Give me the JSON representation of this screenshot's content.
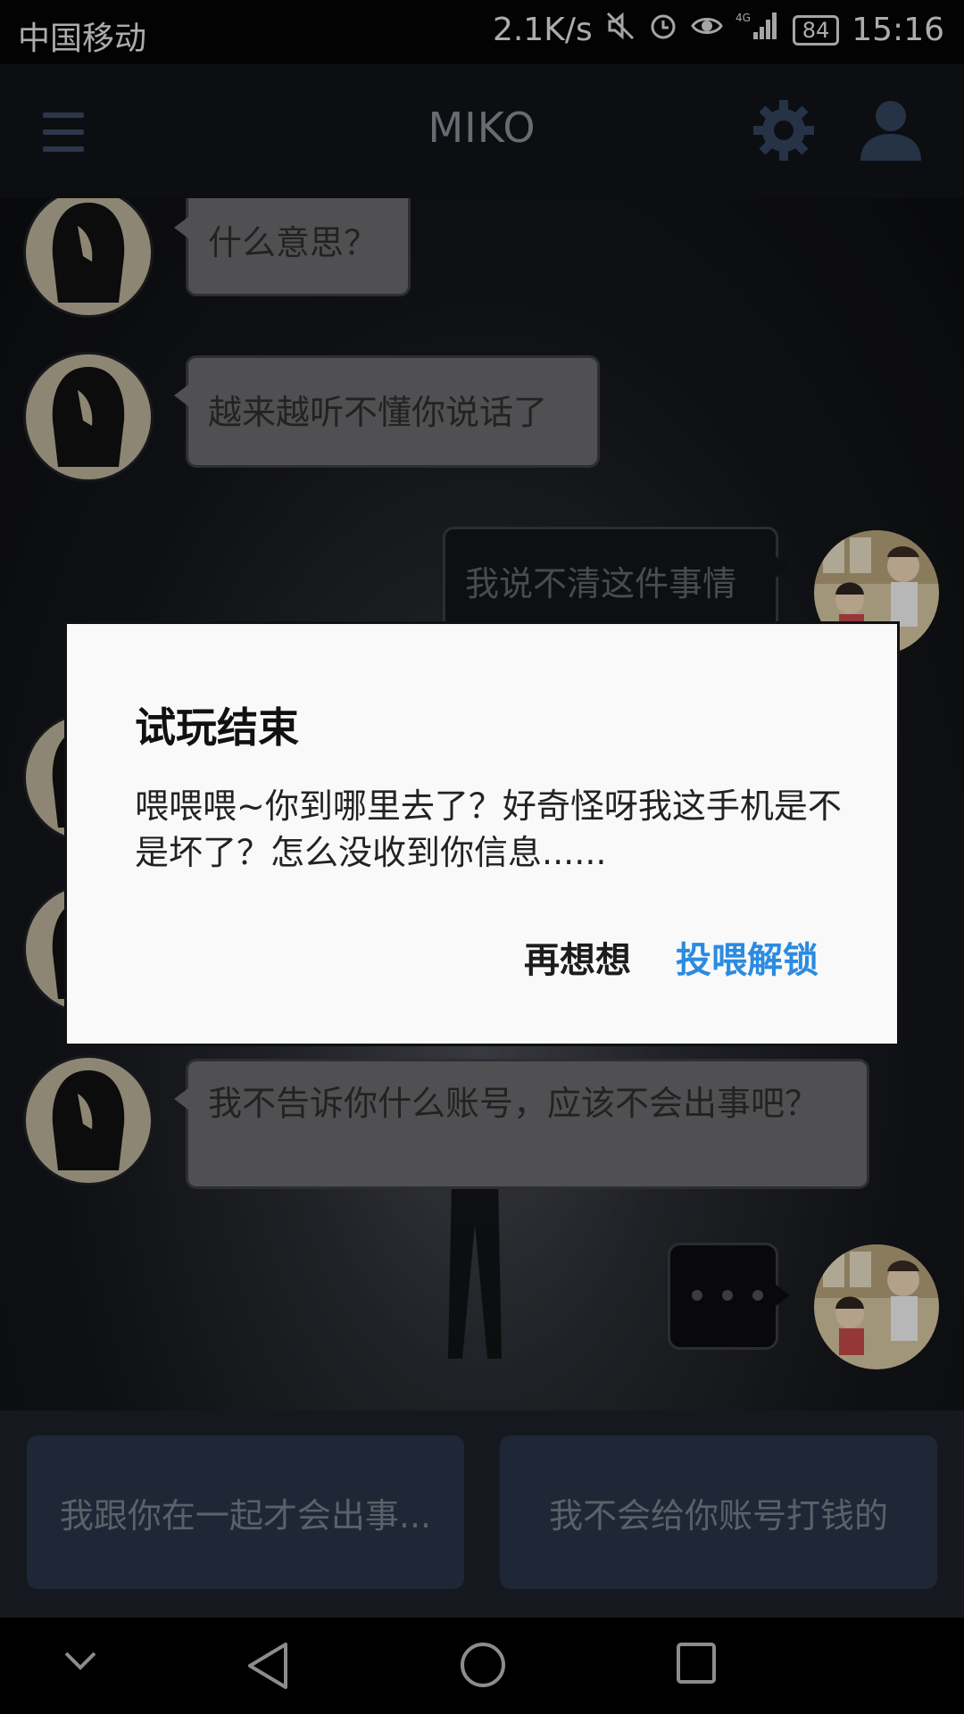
{
  "status_bar": {
    "carrier": "中国移动",
    "speed": "2.1K/s",
    "network": "4G",
    "battery": "84",
    "time": "15:16",
    "icons": [
      "mute-icon",
      "alarm-icon",
      "eye-icon",
      "signal-icon",
      "battery-icon"
    ]
  },
  "header": {
    "title": "MIKO",
    "icons": [
      "menu-icon",
      "gear-icon",
      "user-icon"
    ]
  },
  "chat": {
    "messages": [
      {
        "from": "her",
        "text": "什么意思？"
      },
      {
        "from": "her",
        "text": "越来越听不懂你说话了"
      },
      {
        "from": "me",
        "text": "我说不清这件事情"
      },
      {
        "from": "her",
        "text": "我不告诉你什么账号，应该不会出事吧？"
      },
      {
        "from": "me",
        "text": "typing"
      }
    ]
  },
  "dialog": {
    "title": "试玩结束",
    "message": "喂喂喂~你到哪里去了？好奇怪呀我这手机是不是坏了？怎么没收到你信息......",
    "cancel_label": "再想想",
    "confirm_label": "投喂解锁",
    "confirm_color": "#2b8be0"
  },
  "choices": [
    {
      "label": "我跟你在一起才会出事..."
    },
    {
      "label": "我不会给你账号打钱的"
    }
  ],
  "nav_bar": {
    "icons": [
      "chevron-down-icon",
      "back-icon",
      "home-icon",
      "recents-icon"
    ]
  }
}
